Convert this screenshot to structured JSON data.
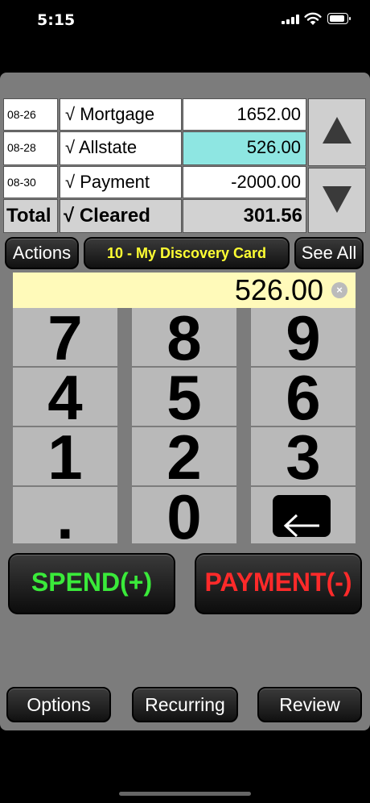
{
  "status_bar": {
    "time": "5:15"
  },
  "transactions": [
    {
      "date": "08-26",
      "check": "√",
      "desc": "Mortgage",
      "amount": "1652.00"
    },
    {
      "date": "08-28",
      "check": "√",
      "desc": "Allstate",
      "amount": "526.00"
    },
    {
      "date": "08-30",
      "check": "√",
      "desc": "Payment",
      "amount": "-2000.00"
    }
  ],
  "totals": {
    "label": "Total",
    "check": "√",
    "desc": "Cleared",
    "amount": "301.56"
  },
  "toolbar": {
    "actions": "Actions",
    "account": "10 - My Discovery Card",
    "see_all": "See All"
  },
  "entry": {
    "value": "526.00"
  },
  "keypad": {
    "keys": [
      "7",
      "8",
      "9",
      "4",
      "5",
      "6",
      "1",
      "2",
      "3",
      ".",
      "0"
    ]
  },
  "actions": {
    "spend": "SPEND(+)",
    "payment": "PAYMENT(-)"
  },
  "bottom_bar": {
    "options": "Options",
    "recurring": "Recurring",
    "review": "Review"
  },
  "colors": {
    "highlight": "#8ee6e2",
    "spend": "#3aea3a",
    "payment": "#ff2a2a",
    "account_text": "#ffff33",
    "entry_bg": "#fffaba"
  }
}
